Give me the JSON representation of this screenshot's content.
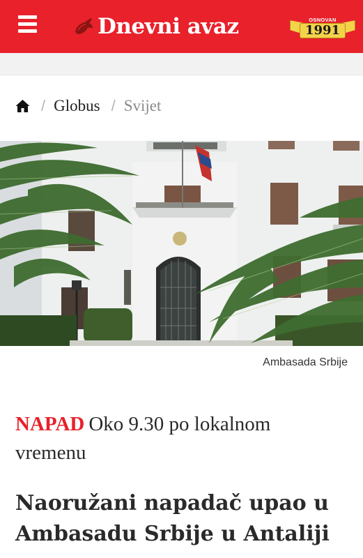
{
  "header": {
    "brand_name": "Dnevni avaz",
    "badge_label": "OSNOVAN",
    "badge_year": "1991",
    "brand_color": "#e8212b",
    "menu_icon": "hamburger-menu-icon"
  },
  "breadcrumb": {
    "home_icon": "home-icon",
    "items": [
      {
        "label": "Globus"
      },
      {
        "label": "Svijet"
      }
    ]
  },
  "article": {
    "image_caption": "Ambasada Srbije",
    "kicker": "NAPAD",
    "subtitle": "Oko 9.30 po lokalnom vremenu",
    "title": "Naoružani napadač upao u Ambasadu Srbije u Antaliji"
  }
}
